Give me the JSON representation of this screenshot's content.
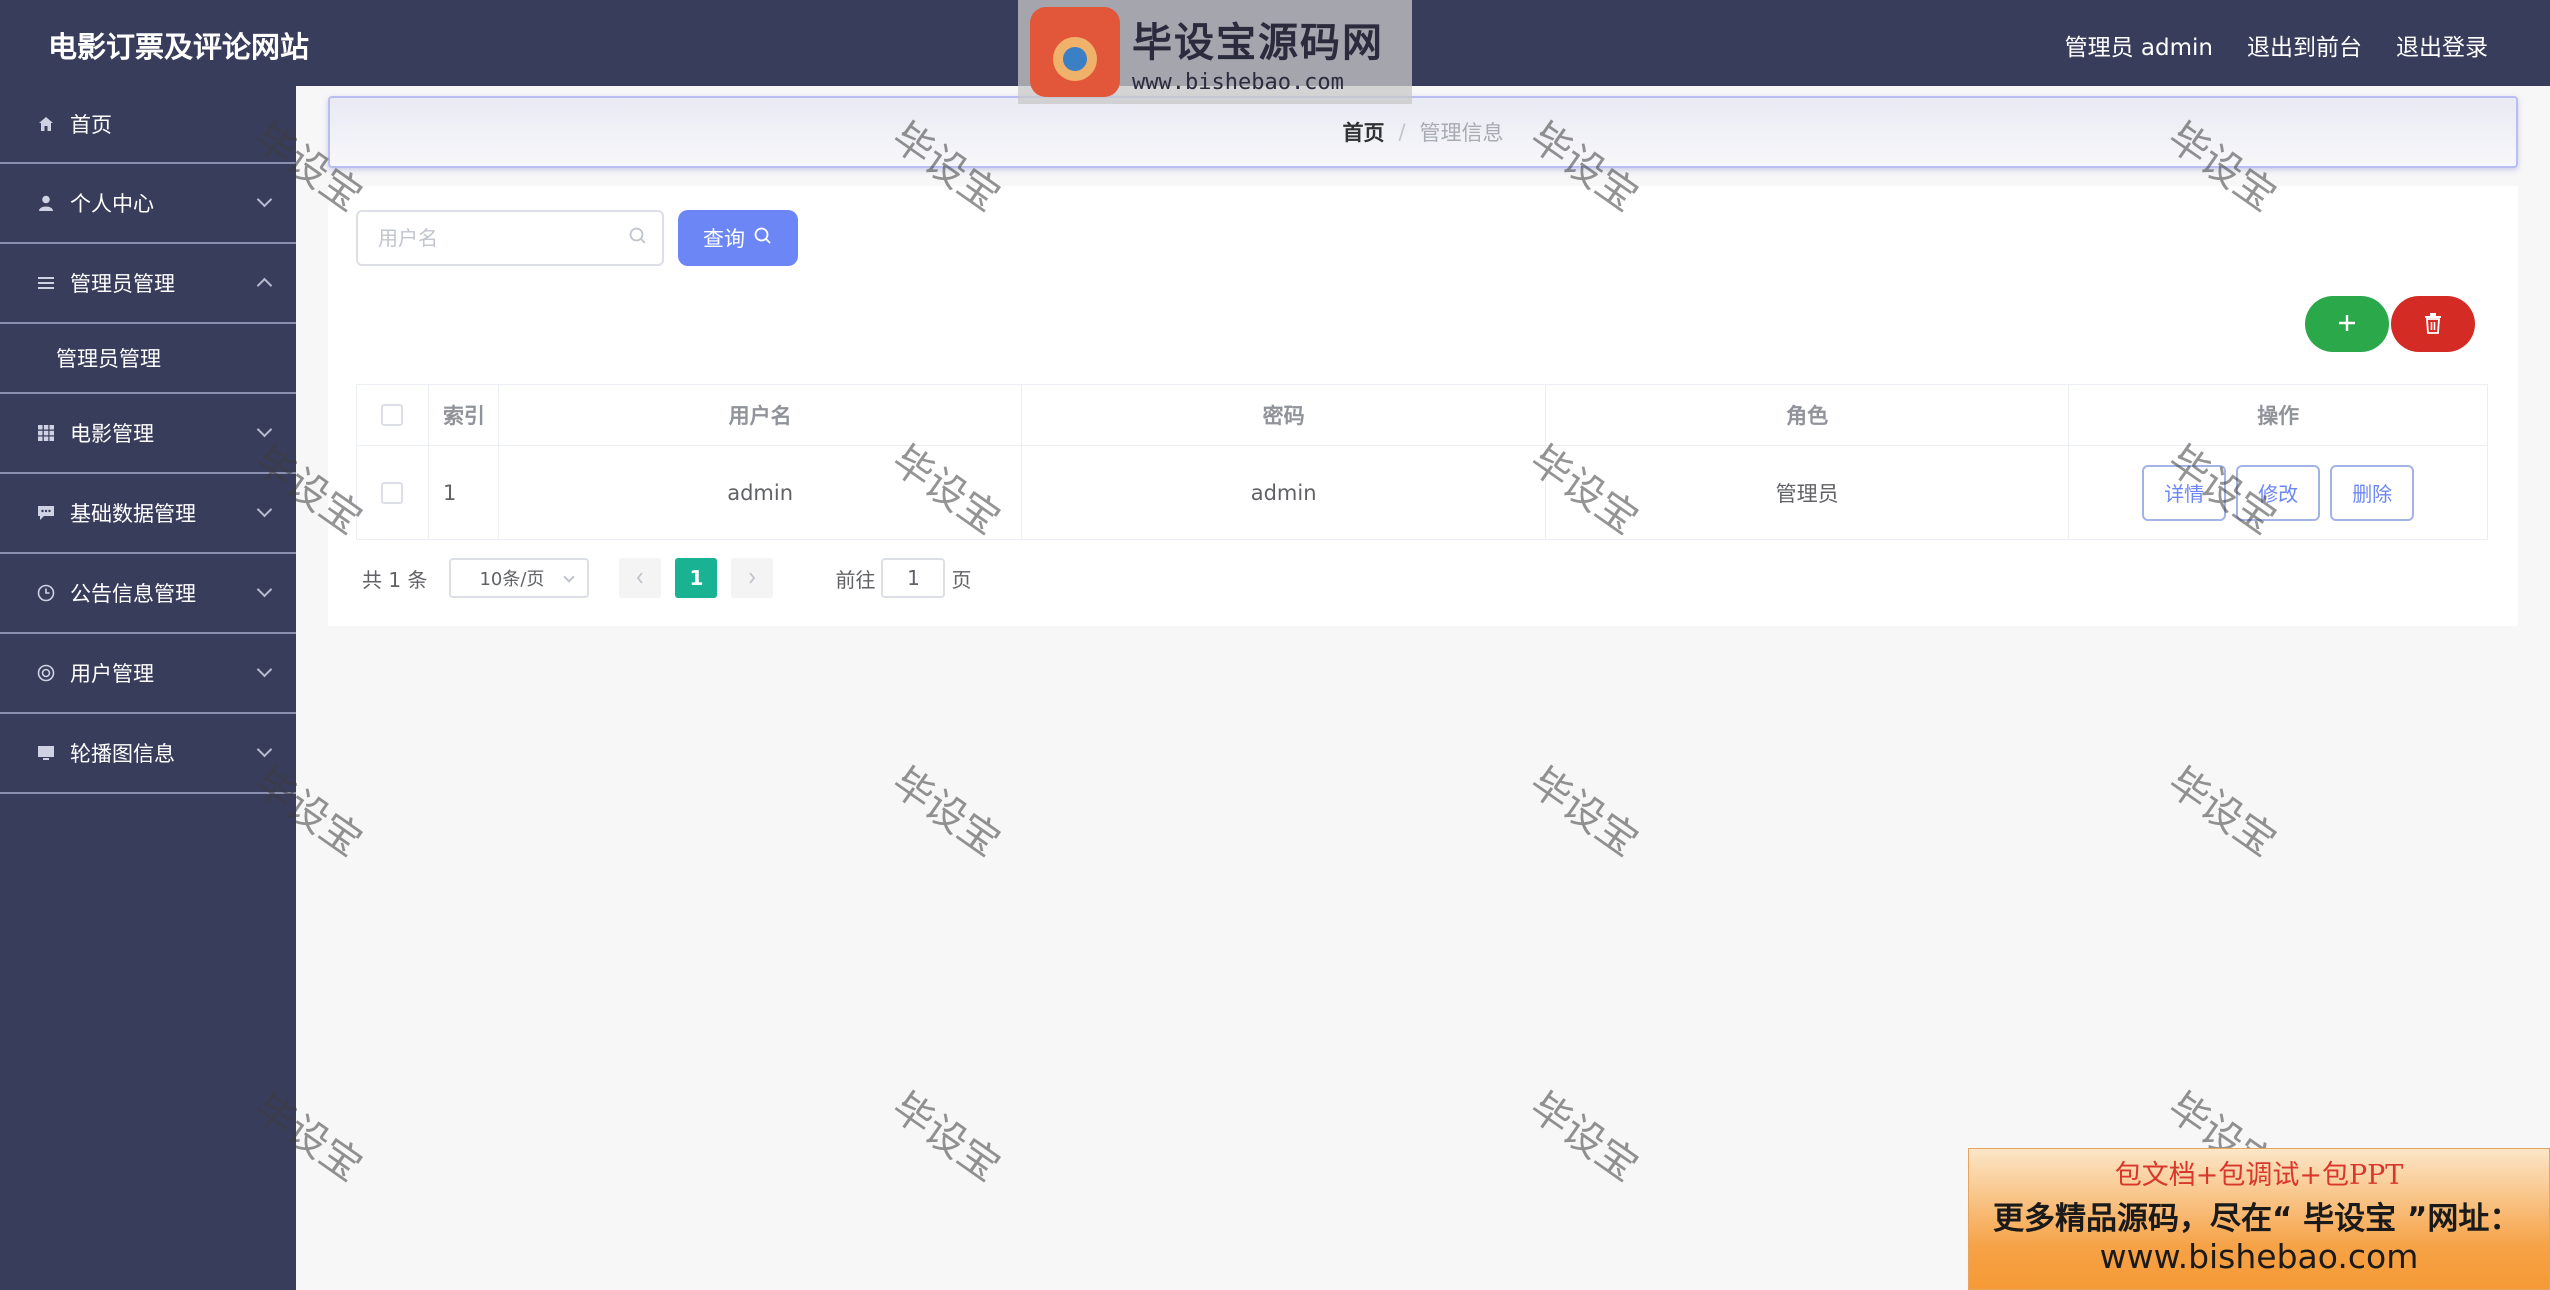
{
  "header": {
    "site_title": "电影订票及评论网站",
    "user_label": "管理员 admin",
    "back_to_front": "退出到前台",
    "logout": "退出登录"
  },
  "sidebar": {
    "items": [
      {
        "label": "首页",
        "icon": "home-icon"
      },
      {
        "label": "个人中心",
        "icon": "user-icon"
      },
      {
        "label": "管理员管理",
        "icon": "list-icon"
      },
      {
        "label": "管理员管理",
        "icon": ""
      },
      {
        "label": "电影管理",
        "icon": "grid-icon"
      },
      {
        "label": "基础数据管理",
        "icon": "chat-icon"
      },
      {
        "label": "公告信息管理",
        "icon": "clock-icon"
      },
      {
        "label": "用户管理",
        "icon": "lifebuoy-icon"
      },
      {
        "label": "轮播图信息",
        "icon": "monitor-icon"
      }
    ]
  },
  "breadcrumb": {
    "home": "首页",
    "separator": "/",
    "current": "管理信息"
  },
  "search": {
    "placeholder": "用户名",
    "query_label": "查询"
  },
  "table": {
    "headers": [
      "索引",
      "用户名",
      "密码",
      "角色",
      "操作"
    ],
    "rows": [
      {
        "index": "1",
        "username": "admin",
        "password": "admin",
        "role": "管理员"
      }
    ],
    "actions": {
      "detail": "详情",
      "edit": "修改",
      "delete": "删除"
    }
  },
  "pagination": {
    "total": "共 1 条",
    "page_size": "10条/页",
    "current_page": "1",
    "goto_label": "前往",
    "goto_value": "1",
    "page_suffix": "页"
  },
  "watermark": {
    "logo_title": "毕设宝源码网",
    "logo_url": "www.bishebao.com",
    "tile_text": "毕设宝"
  },
  "ad": {
    "line1": "包文档+包调试+包PPT",
    "line2": "更多精品源码，尽在“ 毕设宝 ”网址：",
    "line3": "www.bishebao.com"
  },
  "colors": {
    "header_bg": "#383d5b",
    "sidebar_bg": "#383d5b",
    "query_button": "#6c86f5",
    "add_button": "#2aa84a",
    "delete_button": "#d42b25",
    "active_page": "#19b394"
  }
}
